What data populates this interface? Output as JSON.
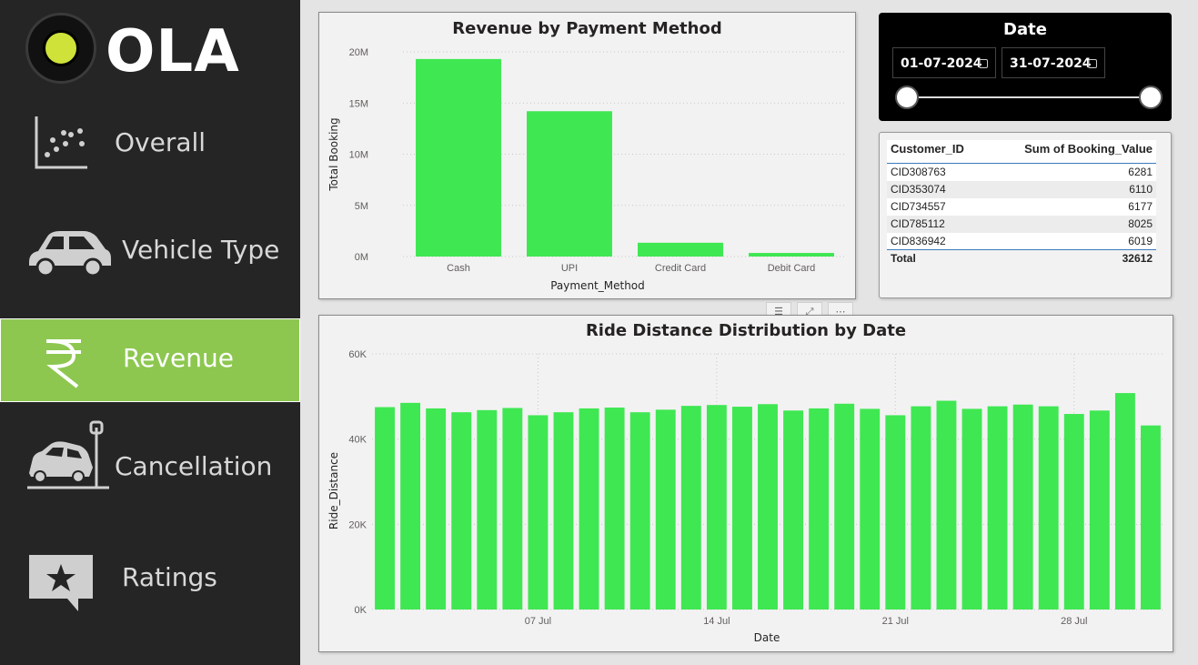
{
  "brand": {
    "name": "OLA"
  },
  "sidebar": {
    "items": [
      {
        "label": "Overall",
        "icon": "scatter-chart-icon",
        "active": false
      },
      {
        "label": "Vehicle Type",
        "icon": "car-icon",
        "active": false
      },
      {
        "label": "Revenue",
        "icon": "rupee-icon",
        "active": true
      },
      {
        "label": "Cancellation",
        "icon": "car-crash-icon",
        "active": false
      },
      {
        "label": "Ratings",
        "icon": "star-message-icon",
        "active": false
      }
    ],
    "accent": "#8dc750"
  },
  "date_slicer": {
    "title": "Date",
    "start": "01-07-2024",
    "end": "31-07-2024"
  },
  "booking_table": {
    "headers": [
      "Customer_ID",
      "Sum of Booking_Value"
    ],
    "rows": [
      [
        "CID308763",
        "6281"
      ],
      [
        "CID353074",
        "6110"
      ],
      [
        "CID734557",
        "6177"
      ],
      [
        "CID785112",
        "8025"
      ],
      [
        "CID836942",
        "6019"
      ]
    ],
    "total_label": "Total",
    "total_value": "32612"
  },
  "chart_data": [
    {
      "type": "bar",
      "title": "Revenue by Payment Method",
      "xlabel": "Payment_Method",
      "ylabel": "Total Booking",
      "categories": [
        "Cash",
        "UPI",
        "Credit Card",
        "Debit Card"
      ],
      "values": [
        19300000,
        14200000,
        1350000,
        350000
      ],
      "ylim": [
        0,
        20000000
      ],
      "yticks": [
        "0M",
        "5M",
        "10M",
        "15M",
        "20M"
      ],
      "color": "#3fe752",
      "grid": true
    },
    {
      "type": "bar",
      "title": "Ride Distance Distribution by Date",
      "xlabel": "Date",
      "ylabel": "Ride_Distance",
      "x": [
        "2024-07-01",
        "2024-07-02",
        "2024-07-03",
        "2024-07-04",
        "2024-07-05",
        "2024-07-06",
        "2024-07-07",
        "2024-07-08",
        "2024-07-09",
        "2024-07-10",
        "2024-07-11",
        "2024-07-12",
        "2024-07-13",
        "2024-07-14",
        "2024-07-15",
        "2024-07-16",
        "2024-07-17",
        "2024-07-18",
        "2024-07-19",
        "2024-07-20",
        "2024-07-21",
        "2024-07-22",
        "2024-07-23",
        "2024-07-24",
        "2024-07-25",
        "2024-07-26",
        "2024-07-27",
        "2024-07-28",
        "2024-07-29",
        "2024-07-30",
        "2024-07-31"
      ],
      "values": [
        47500,
        48500,
        47200,
        46300,
        46800,
        47300,
        45600,
        46300,
        47200,
        47400,
        46300,
        46900,
        47800,
        48000,
        47600,
        48200,
        46700,
        47200,
        48300,
        47100,
        45600,
        47700,
        49000,
        47100,
        47700,
        48100,
        47700,
        45900,
        46700,
        50800,
        43200
      ],
      "ylim": [
        0,
        60000
      ],
      "yticks": [
        "0K",
        "20K",
        "40K",
        "60K"
      ],
      "xtick_labels": [
        {
          "at": "2024-07-07",
          "label": "07 Jul"
        },
        {
          "at": "2024-07-14",
          "label": "14 Jul"
        },
        {
          "at": "2024-07-21",
          "label": "21 Jul"
        },
        {
          "at": "2024-07-28",
          "label": "28 Jul"
        }
      ],
      "color": "#3fe752",
      "grid": true
    }
  ]
}
